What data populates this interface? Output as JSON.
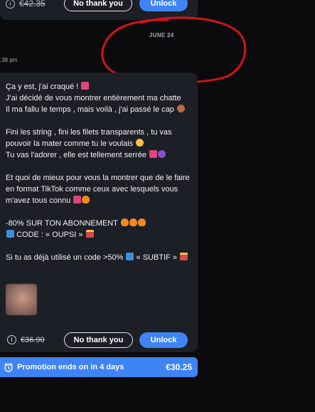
{
  "top_card": {
    "old_price": "€42.35",
    "no_thanks_label": "No thank you",
    "unlock_label": "Unlock"
  },
  "date_separator": "JUNE 24",
  "time_label": ":38 pm",
  "message": {
    "lines": [
      "Ça y est, j'ai craqué !",
      "J'ai décidé de vous montrer entièrement ma chatte",
      "Il ma fallu le temps , mais voilà , j'ai passé le cap",
      "",
      "Fini les string , fini les filets transparents , tu vas",
      "pouvoir la mater comme tu le voulais",
      "Tu vas l'adorer , elle est tellement serrée",
      "",
      "Et quoi de mieux pour vous la montrer que de le faire",
      "en format TikTok comme ceux avec lesquels vous",
      "m'avez tous connu",
      "",
      "-80% SUR TON ABONNEMENT",
      "CODE : « OUPSI »",
      "",
      "Si tu as déjà utilisé un code >50%",
      "« SUBTIF »"
    ]
  },
  "bottom_card": {
    "old_price": "€36.90",
    "no_thanks_label": "No thank you",
    "unlock_label": "Unlock"
  },
  "promo": {
    "text": "Promotion ends on in 4 days",
    "price": "€30.25"
  },
  "colors": {
    "accent": "#3f84f3",
    "card": "#1c1f26",
    "background": "#0b0b0d",
    "annotation": "#d0141b"
  },
  "icons": [
    "info-icon",
    "alarm-clock-icon"
  ]
}
